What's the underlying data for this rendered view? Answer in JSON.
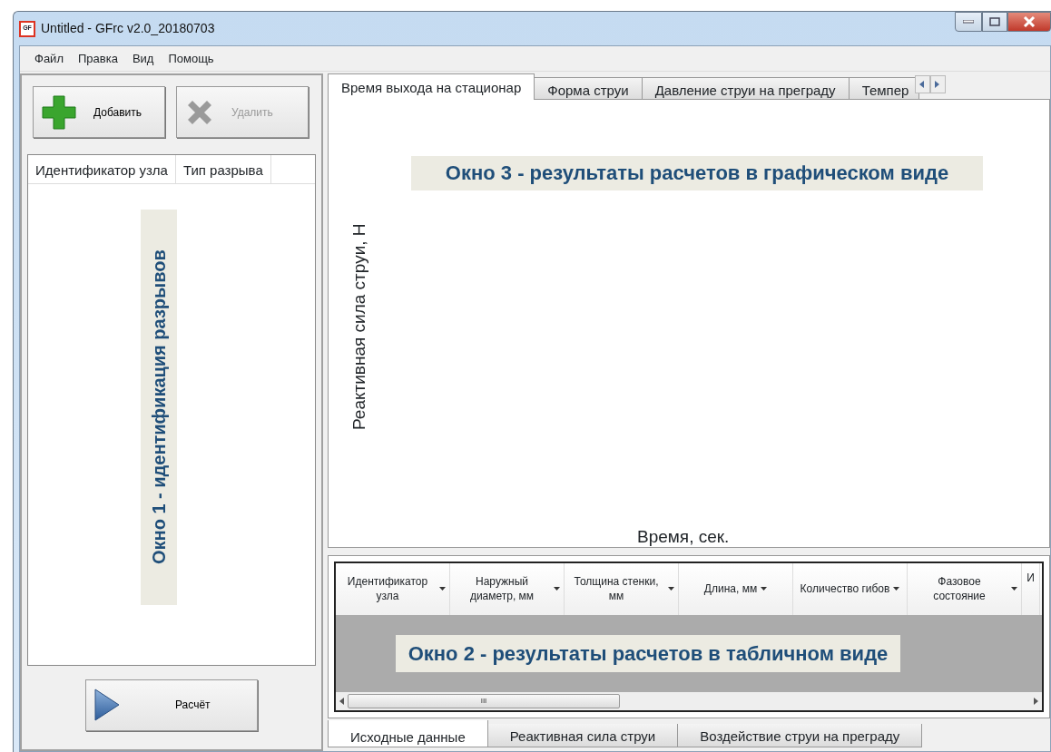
{
  "window": {
    "title": "Untitled - GFrc v2.0_20180703",
    "icon_text": "GF"
  },
  "menu": [
    "Файл",
    "Правка",
    "Вид",
    "Помощь"
  ],
  "left_panel": {
    "buttons": [
      {
        "label": "Добавить",
        "kind": "add",
        "disabled": false
      },
      {
        "label": "Удалить",
        "kind": "delete",
        "disabled": true
      }
    ],
    "columns": [
      "Идентификатор узла",
      "Тип разрыва"
    ],
    "overlay_label": "Окно 1 - идентификация разрывов",
    "run_button": "Расчёт"
  },
  "chart_tabs": [
    {
      "label": "Время выхода на стационар",
      "selected": true
    },
    {
      "label": "Форма струи",
      "selected": false
    },
    {
      "label": "Давление струи на преграду",
      "selected": false
    },
    {
      "label": "Темпер",
      "selected": false
    }
  ],
  "chart": {
    "overlay_label": "Окно 3 - результаты расчетов в графическом виде",
    "ylabel": "Реактивная сила струи, Н",
    "xlabel": "Время, сек."
  },
  "table": {
    "columns": [
      "Идентификатор узла",
      "Наружный диаметр, мм",
      "Толщина стенки, мм",
      "Длина, мм",
      "Количество гибов",
      "Фазовое состояние",
      "И"
    ],
    "overlay_label": "Окно 2 - результаты расчетов в табличном виде",
    "scroll_grip": "III"
  },
  "bottom_tabs": [
    {
      "label": "Исходные данные",
      "selected": true
    },
    {
      "label": "Реактивная сила струи",
      "selected": false
    },
    {
      "label": "Воздействие струи на преграду",
      "selected": false
    }
  ]
}
